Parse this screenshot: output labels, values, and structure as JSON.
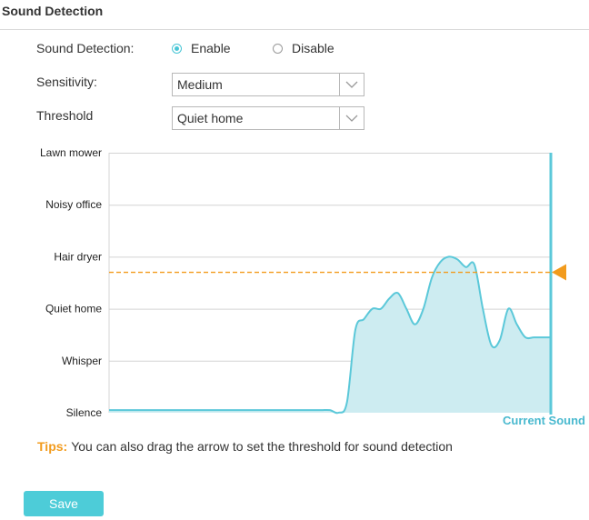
{
  "section": {
    "title": "Sound Detection"
  },
  "form": {
    "sound_detection_label": "Sound Detection:",
    "enable_label": "Enable",
    "disable_label": "Disable",
    "selected": "Enable",
    "sensitivity_label": "Sensitivity:",
    "sensitivity_value": "Medium",
    "threshold_label": "Threshold",
    "threshold_value": "Quiet home"
  },
  "chart_data": {
    "type": "area",
    "y_levels": [
      "Silence",
      "Whisper",
      "Quiet home",
      "Hair dryer",
      "Noisy office",
      "Lawn mower"
    ],
    "ylim": [
      0,
      5
    ],
    "threshold_level": 2.7,
    "series": [
      {
        "values": [
          0.05,
          0.05,
          0.05,
          0.05,
          0.05,
          0.05,
          0.05,
          0.05,
          0.05,
          0.05,
          0.05,
          0.05,
          0.05,
          0.05,
          0.05,
          0.05,
          0.05,
          0.05,
          0.05,
          0.05,
          0.05,
          0.05,
          0.05,
          0.05,
          0.05,
          0.05,
          0.05,
          0.0,
          0.2,
          1.6,
          1.8,
          2.0,
          2.0,
          2.2,
          2.3,
          2.0,
          1.7,
          2.0,
          2.6,
          2.9,
          3.0,
          2.95,
          2.8,
          2.85,
          2.0,
          1.3,
          1.4,
          2.0,
          1.7,
          1.45,
          1.45,
          1.45,
          1.45
        ]
      }
    ],
    "current_sound_label": "Current Sound",
    "colors": {
      "line": "#5bc8d9",
      "fill": "#cdecf1",
      "threshold": "#f29b1d",
      "grid": "#d4d4d4"
    }
  },
  "tips": {
    "label": "Tips:",
    "text": "You can also drag the arrow to set the threshold for sound detection"
  },
  "actions": {
    "save_label": "Save"
  }
}
